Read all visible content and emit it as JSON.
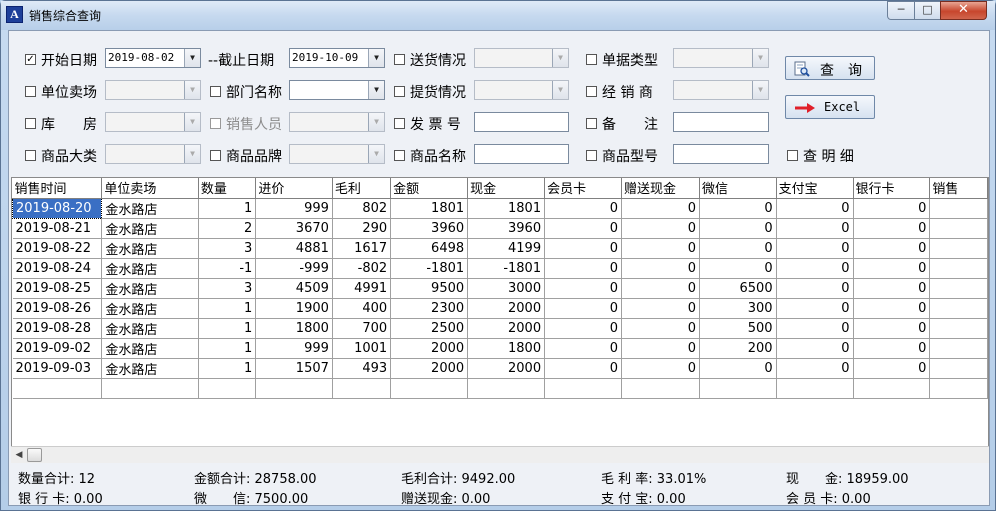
{
  "window": {
    "title": "销售综合查询",
    "app_icon": "A",
    "min": "─",
    "max": "□",
    "close": "✕"
  },
  "filters": {
    "start_date": {
      "label": "开始日期",
      "checked": true,
      "value": "2019-08-02"
    },
    "end_date": {
      "label": "--截止日期",
      "value": "2019-10-09"
    },
    "delivery": {
      "label": "送货情况",
      "value": ""
    },
    "doc_type": {
      "label": "单据类型",
      "value": ""
    },
    "store": {
      "label": "单位卖场",
      "value": ""
    },
    "department": {
      "label": "部门名称",
      "value": ""
    },
    "pickup": {
      "label": "提货情况",
      "value": ""
    },
    "dealer": {
      "label": "经 销 商",
      "value": ""
    },
    "warehouse": {
      "label": "库　　房",
      "value": ""
    },
    "salesperson": {
      "label": "销售人员",
      "value": ""
    },
    "invoice": {
      "label": "发 票 号",
      "value": ""
    },
    "remark": {
      "label": "备　　注",
      "value": ""
    },
    "category": {
      "label": "商品大类",
      "value": ""
    },
    "brand": {
      "label": "商品品牌",
      "value": ""
    },
    "product_name": {
      "label": "商品名称",
      "value": ""
    },
    "model": {
      "label": "商品型号",
      "value": ""
    },
    "detail": {
      "label": "查 明 细"
    }
  },
  "buttons": {
    "query": "查　询",
    "excel": "Excel"
  },
  "table": {
    "columns": [
      "销售时间",
      "单位卖场",
      "数量",
      "进价",
      "毛利",
      "金额",
      "现金",
      "会员卡",
      "赠送现金",
      "微信",
      "支付宝",
      "银行卡",
      "销售"
    ],
    "rows": [
      [
        "2019-08-20",
        "金水路店",
        "1",
        "999",
        "802",
        "1801",
        "1801",
        "0",
        "0",
        "0",
        "0",
        "0"
      ],
      [
        "2019-08-21",
        "金水路店",
        "2",
        "3670",
        "290",
        "3960",
        "3960",
        "0",
        "0",
        "0",
        "0",
        "0"
      ],
      [
        "2019-08-22",
        "金水路店",
        "3",
        "4881",
        "1617",
        "6498",
        "4199",
        "0",
        "0",
        "0",
        "0",
        "0"
      ],
      [
        "2019-08-24",
        "金水路店",
        "-1",
        "-999",
        "-802",
        "-1801",
        "-1801",
        "0",
        "0",
        "0",
        "0",
        "0"
      ],
      [
        "2019-08-25",
        "金水路店",
        "3",
        "4509",
        "4991",
        "9500",
        "3000",
        "0",
        "0",
        "6500",
        "0",
        "0"
      ],
      [
        "2019-08-26",
        "金水路店",
        "1",
        "1900",
        "400",
        "2300",
        "2000",
        "0",
        "0",
        "300",
        "0",
        "0"
      ],
      [
        "2019-08-28",
        "金水路店",
        "1",
        "1800",
        "700",
        "2500",
        "2000",
        "0",
        "0",
        "500",
        "0",
        "0"
      ],
      [
        "2019-09-02",
        "金水路店",
        "1",
        "999",
        "1001",
        "2000",
        "1800",
        "0",
        "0",
        "200",
        "0",
        "0"
      ],
      [
        "2019-09-03",
        "金水路店",
        "1",
        "1507",
        "493",
        "2000",
        "2000",
        "0",
        "0",
        "0",
        "0",
        "0"
      ]
    ]
  },
  "summary": {
    "qty": "数量合计: 12",
    "amount": "金额合计: 28758.00",
    "profit": "毛利合计: 9492.00",
    "margin": "毛 利 率: 33.01%",
    "cash": "现　　金: 18959.00",
    "bank": "银 行 卡: 0.00",
    "wechat": "微　　信: 7500.00",
    "gift_cash": "赠送现金: 0.00",
    "alipay": "支 付 宝: 0.00",
    "member": "会 员 卡: 0.00"
  }
}
